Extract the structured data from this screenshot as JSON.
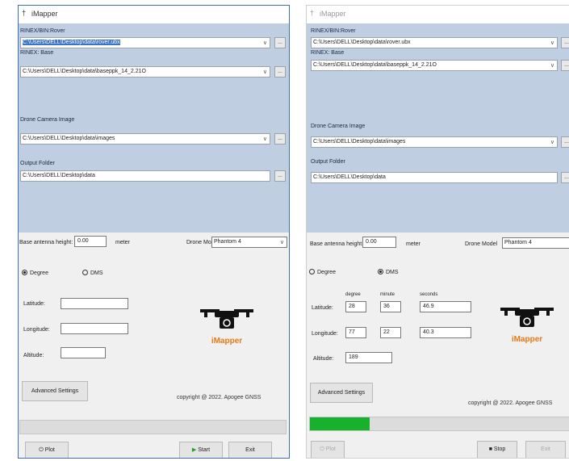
{
  "left": {
    "app_title": "iMapper",
    "rover_label": "RINEX/BIN:Rover",
    "rover_value": "C:\\Users\\DELL\\Desktop\\data\\rover.ubx",
    "base_label": "RINEX: Base",
    "base_value": "C:\\Users\\DELL\\Desktop\\data\\baseppk_14_2.21O",
    "images_label": "Drone Camera Image",
    "images_value": "C:\\Users\\DELL\\Desktop\\data\\images",
    "output_label": "Output Folder",
    "output_value": "C:\\Users\\DELL\\Desktop\\data",
    "browse_label": "...",
    "antenna_label": "Base antenna height:",
    "antenna_value": "0.00",
    "antenna_unit": "meter",
    "model_label": "Drone Model",
    "model_value": "Phantom 4",
    "degree_label": "Degree",
    "dms_label": "DMS",
    "latitude_label": "Latitude:",
    "longitude_label": "Longitude:",
    "altitude_label": "Altitude:",
    "latitude_value": "",
    "longitude_value": "",
    "altitude_value": "",
    "brand": "iMapper",
    "advanced_label": "Advanced Settings",
    "copyright": "copyright @ 2022. Apogee GNSS",
    "progress": 0,
    "plot_label": "Plot",
    "start_label": "Start",
    "exit_label": "Exit"
  },
  "right": {
    "app_title": "iMapper",
    "rover_label": "RINEX/BIN:Rover",
    "rover_value": "C:\\Users\\DELL\\Desktop\\data\\rover.ubx",
    "base_label": "RINEX: Base",
    "base_value": "C:\\Users\\DELL\\Desktop\\data\\baseppk_14_2.21O",
    "images_label": "Drone Camera Image",
    "images_value": "C:\\Users\\DELL\\Desktop\\data\\images",
    "output_label": "Output Folder",
    "output_value": "C:\\Users\\DELL\\Desktop\\data",
    "browse_label": "...",
    "antenna_label": "Base antenna height:",
    "antenna_value": "0.00",
    "antenna_unit": "meter",
    "model_label": "Drone Model",
    "model_value": "Phantom 4",
    "degree_label": "Degree",
    "dms_label": "DMS",
    "col_degree": "degree",
    "col_minute": "minute",
    "col_seconds": "seconds",
    "latitude_label": "Latitude:",
    "lat_deg": "28",
    "lat_min": "36",
    "lat_sec": "46.9",
    "longitude_label": "Longitude:",
    "lon_deg": "77",
    "lon_min": "22",
    "lon_sec": "40.3",
    "altitude_label": "Altitude:",
    "altitude_value": "189",
    "brand": "iMapper",
    "advanced_label": "Advanced Settings",
    "copyright": "copyright @ 2022. Apogee GNSS",
    "progress": 0.23,
    "plot_label": "Plot",
    "stop_label": "Stop",
    "exit_label": "Exit"
  },
  "colors": {
    "panel_blue": "#bfcee0",
    "progress_green": "#16b22c",
    "brand_orange": "#e67a18"
  }
}
